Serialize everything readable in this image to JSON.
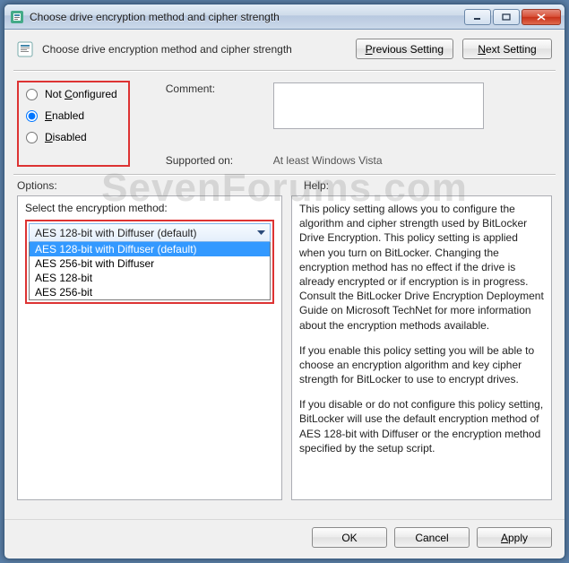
{
  "window": {
    "title": "Choose drive encryption method and cipher strength"
  },
  "header": {
    "subtitle": "Choose drive encryption method and cipher strength",
    "prev_btn": "Previous Setting",
    "next_btn": "Next Setting"
  },
  "radios": {
    "not_configured": "Not Configured",
    "enabled": "Enabled",
    "disabled": "Disabled",
    "selected": "enabled"
  },
  "comment": {
    "label": "Comment:",
    "value": ""
  },
  "supported": {
    "label": "Supported on:",
    "value": "At least Windows Vista"
  },
  "columns": {
    "options": "Options:",
    "help": "Help:"
  },
  "options": {
    "label": "Select the encryption method:",
    "selected": "AES 128-bit with Diffuser (default)",
    "items": [
      "AES 128-bit with Diffuser (default)",
      "AES 256-bit with Diffuser",
      "AES 128-bit",
      "AES 256-bit"
    ]
  },
  "help": {
    "p1": "This policy setting allows you to configure the algorithm and cipher strength used by BitLocker Drive Encryption. This policy setting is applied when you turn on BitLocker. Changing the encryption method has no effect if the drive is already encrypted or if encryption is in progress. Consult the BitLocker Drive Encryption Deployment Guide on Microsoft TechNet for more information about the encryption methods available.",
    "p2": "If you enable this policy setting you will be able to choose an encryption algorithm and key cipher strength for BitLocker to use to encrypt drives.",
    "p3": "If you disable or do not configure this policy setting, BitLocker will use the default encryption method of AES 128-bit with Diffuser or the encryption method specified by the setup script."
  },
  "footer": {
    "ok": "OK",
    "cancel": "Cancel",
    "apply": "Apply"
  },
  "watermark": "SevenForums.com"
}
